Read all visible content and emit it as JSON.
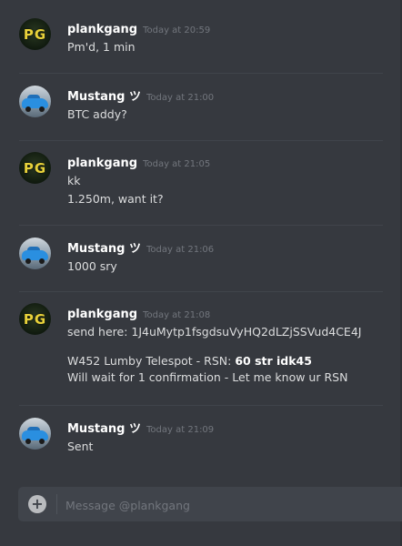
{
  "messages": [
    {
      "author": "plankgang",
      "avatar_text": "PG",
      "timestamp": "Today at 20:59",
      "lines": [
        "Pm'd, 1 min"
      ]
    },
    {
      "author": "Mustang ツ",
      "timestamp": "Today at 21:00",
      "lines": [
        "BTC addy?"
      ]
    },
    {
      "author": "plankgang",
      "avatar_text": "PG",
      "timestamp": "Today at 21:05",
      "lines": [
        "kk",
        "1.250m, want it?"
      ]
    },
    {
      "author": "Mustang ツ",
      "timestamp": "Today at 21:06",
      "lines": [
        "1000 sry"
      ]
    },
    {
      "author": "plankgang",
      "avatar_text": "PG",
      "timestamp": "Today at 21:08",
      "lines": [
        "send here: 1J4uMytp1fsgdsuVyHQ2dLZjSSVud4CE4J",
        "W452 Lumby Telespot - RSN: ",
        "60 str idk45",
        "Will wait for 1 confirmation - Let me know ur RSN"
      ]
    },
    {
      "author": "Mustang ツ",
      "timestamp": "Today at 21:09",
      "lines": [
        "Sent"
      ]
    }
  ],
  "composer": {
    "placeholder": "Message @plankgang",
    "add_icon": "plus-circle-icon"
  },
  "colors": {
    "background": "#36393f",
    "input_background": "#40444b",
    "username": "#ffffff",
    "timestamp": "#72767d",
    "text": "#dcddde",
    "pg_avatar_text": "#e8d23a"
  }
}
